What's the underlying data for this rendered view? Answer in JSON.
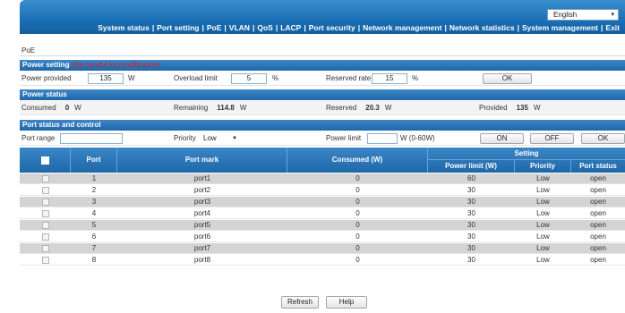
{
  "nav": {
    "language": "English",
    "items": [
      "System status",
      "Port setting",
      "PoE",
      "VLAN",
      "QoS",
      "LACP",
      "Port security",
      "Network management",
      "Network statistics",
      "System management",
      "Exit"
    ]
  },
  "breadcrumb": "PoE",
  "power_setting": {
    "title": "Power setting",
    "warning": "(Be careful for modification)",
    "power_provided_label": "Power provided",
    "power_provided_value": "135",
    "power_provided_unit": "W",
    "overload_limit_label": "Overload limit",
    "overload_limit_value": "5",
    "overload_limit_unit": "%",
    "reserved_rate_label": "Reserved rate",
    "reserved_rate_value": "15",
    "reserved_rate_unit": "%",
    "ok_label": "OK"
  },
  "power_status": {
    "title": "Power status",
    "consumed_label": "Consumed",
    "consumed_value": "0",
    "consumed_unit": "W",
    "remaining_label": "Remaining",
    "remaining_value": "114.8",
    "remaining_unit": "W",
    "reserved_label": "Reserved",
    "reserved_value": "20.3",
    "reserved_unit": "W",
    "provided_label": "Provided",
    "provided_value": "135",
    "provided_unit": "W"
  },
  "port_control": {
    "title": "Port status and control",
    "port_range_label": "Port range",
    "port_range_value": "",
    "priority_label": "Priority",
    "priority_value": "Low",
    "power_limit_label": "Power limit",
    "power_limit_value": "",
    "power_limit_hint": "W (0-60W)",
    "on_label": "ON",
    "off_label": "OFF",
    "ok_label": "OK"
  },
  "table": {
    "headers": {
      "port": "Port",
      "port_mark": "Port mark",
      "consumed": "Consumed (W)",
      "setting": "Setting",
      "power_limit": "Power limit (W)",
      "priority": "Priority",
      "port_status": "Port status"
    },
    "rows": [
      {
        "port": "1",
        "mark": "port1",
        "consumed": "0",
        "limit": "60",
        "priority": "Low",
        "status": "open"
      },
      {
        "port": "2",
        "mark": "port2",
        "consumed": "0",
        "limit": "30",
        "priority": "Low",
        "status": "open"
      },
      {
        "port": "3",
        "mark": "port3",
        "consumed": "0",
        "limit": "30",
        "priority": "Low",
        "status": "open"
      },
      {
        "port": "4",
        "mark": "port4",
        "consumed": "0",
        "limit": "30",
        "priority": "Low",
        "status": "open"
      },
      {
        "port": "5",
        "mark": "port5",
        "consumed": "0",
        "limit": "30",
        "priority": "Low",
        "status": "open"
      },
      {
        "port": "6",
        "mark": "port6",
        "consumed": "0",
        "limit": "30",
        "priority": "Low",
        "status": "open"
      },
      {
        "port": "7",
        "mark": "port7",
        "consumed": "0",
        "limit": "30",
        "priority": "Low",
        "status": "open"
      },
      {
        "port": "8",
        "mark": "port8",
        "consumed": "0",
        "limit": "30",
        "priority": "Low",
        "status": "open"
      }
    ]
  },
  "footer": {
    "refresh_label": "Refresh",
    "help_label": "Help"
  },
  "colors": {
    "header_blue": "#1f67a8",
    "warning_red": "#e02020",
    "alt_row": "#d4d4d4"
  }
}
